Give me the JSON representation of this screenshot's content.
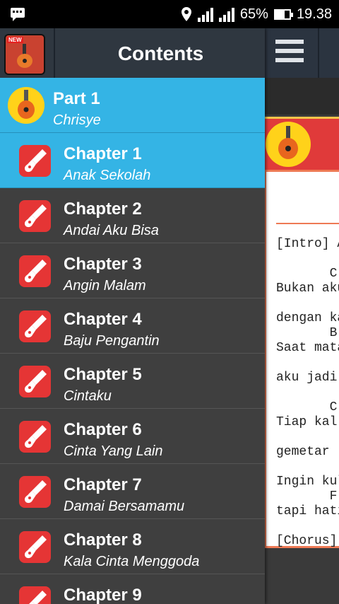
{
  "status_bar": {
    "battery": "65%",
    "battery_level": 0.65,
    "time": "19.38"
  },
  "drawer": {
    "title": "Contents",
    "part": {
      "title": "Part 1",
      "subtitle": "Chrisye"
    },
    "chapters": [
      {
        "title": "Chapter 1",
        "subtitle": "Anak Sekolah",
        "active": true
      },
      {
        "title": "Chapter 2",
        "subtitle": "Andai Aku Bisa"
      },
      {
        "title": "Chapter 3",
        "subtitle": "Angin Malam"
      },
      {
        "title": "Chapter 4",
        "subtitle": "Baju Pengantin"
      },
      {
        "title": "Chapter 5",
        "subtitle": "Cintaku"
      },
      {
        "title": "Chapter 6",
        "subtitle": "Cinta Yang Lain"
      },
      {
        "title": "Chapter 7",
        "subtitle": "Damai Bersamamu"
      },
      {
        "title": "Chapter 8",
        "subtitle": "Kala Cinta Menggoda"
      },
      {
        "title": "Chapter 9",
        "subtitle": ""
      }
    ]
  },
  "content": {
    "lyrics_lines": [
      "[Intro] A",
      "",
      "       C",
      "Bukan aku",
      "",
      "dengan ka",
      "       B",
      "Saat mata",
      "",
      "aku jadi",
      "",
      "       C",
      "Tiap kal",
      "        ",
      "gemetar ",
      "       ",
      "Ingin kul",
      "       F",
      "tapi hati",
      "",
      "[Chorus]"
    ]
  },
  "icons": {
    "notification": "notification-icon",
    "location": "location-icon",
    "menu": "hamburger-menu-icon",
    "guitar": "guitar-icon"
  }
}
